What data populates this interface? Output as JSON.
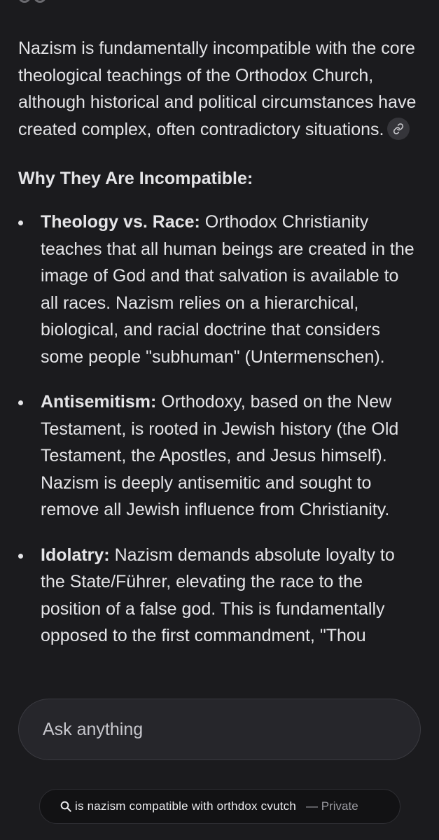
{
  "answer": {
    "intro": "Nazism is fundamentally incompatible with the core theological teachings of the Orthodox Church, although historical and political circumstances have created complex, often contradictory situations.",
    "heading": "Why They Are Incompatible:",
    "points": [
      {
        "term": "Theology vs. Race:",
        "text": " Orthodox Christianity teaches that all human beings are created in the image of God and that salvation is available to all races. Nazism relies on a hierarchical, biological, and racial doctrine that considers some people \"subhuman\" (Untermenschen)."
      },
      {
        "term": "Antisemitism:",
        "text": " Orthodoxy, based on the New Testament, is rooted in Jewish history (the Old Testament, the Apostles, and Jesus himself). Nazism is deeply antisemitic and sought to remove all Jewish influence from Christianity."
      },
      {
        "term": "Idolatry:",
        "text": " Nazism demands absolute loyalty to the State/Führer, elevating the race to the position of a false god. This is fundamentally opposed to the first commandment, \"Thou"
      }
    ],
    "link_icon": "link-icon"
  },
  "composer": {
    "placeholder": "Ask anything"
  },
  "query": {
    "icon": "search-icon",
    "text": "is nazism compatible with orthdox cvutch",
    "private_label": "— Private"
  },
  "colors": {
    "background": "#1b1b1e",
    "text": "#e4e4e7",
    "input_bg": "#26262b",
    "pill_bg": "#121214",
    "muted": "#9a9aa0"
  }
}
